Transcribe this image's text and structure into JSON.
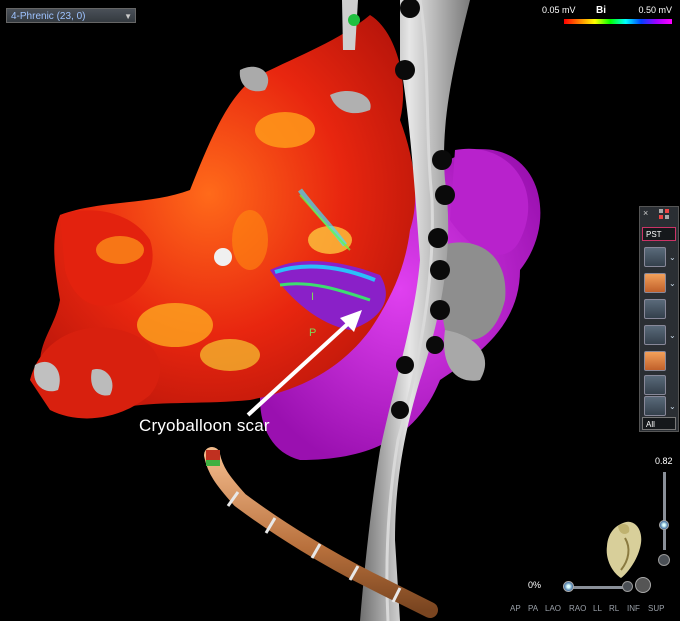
{
  "map_selector": {
    "value": "4-Phrenic (23, 0)"
  },
  "voltage_scale": {
    "low": "0.05 mV",
    "mode": "Bi",
    "high": "0.50 mV",
    "colors": [
      "#ff0000",
      "#ff8000",
      "#ffff00",
      "#00ff00",
      "#00ffff",
      "#0040ff",
      "#a000ff",
      "#ff00ff"
    ]
  },
  "annotation": {
    "text": "Cryoballoon scar"
  },
  "toolbar": {
    "close": "×",
    "dropdown": "PST",
    "filter": "All"
  },
  "zoom": {
    "value": "0.82"
  },
  "transparency": {
    "value": "0%"
  },
  "views": [
    "AP",
    "PA",
    "LAO",
    "RAO",
    "LL",
    "RL",
    "INF",
    "SUP"
  ],
  "map_markers": {
    "letters": [
      "I",
      "P"
    ]
  },
  "colors": {
    "healthy": "#e82a12",
    "scar": "#c21cd8",
    "shell": "#9a9a9a",
    "catheter": "#c98a5a"
  }
}
